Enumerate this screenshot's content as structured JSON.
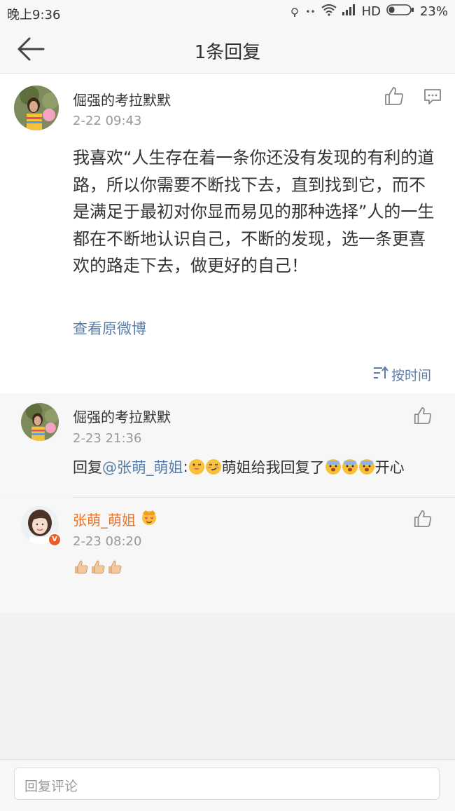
{
  "status_bar": {
    "time": "晚上9:36",
    "network": "HD",
    "battery": "23%"
  },
  "nav": {
    "title": "1条回复",
    "back_icon": "back-arrow-icon"
  },
  "post": {
    "username": "倔强的考拉默默",
    "time": "2-22 09:43",
    "content": "我喜欢“人生存在着一条你还没有发现的有利的道路，所以你需要不断找下去，直到找到它，而不是满足于最初对你显而易见的那种选择”人的一生都在不断地认识自己，不断的发现，选一条更喜欢的路走下去，做更好的自己！",
    "view_original": "查看原微博",
    "sort_label": "按时间"
  },
  "replies": [
    {
      "username": "倔强的考拉默默",
      "time": "2-23 21:36",
      "prefix": "回复",
      "mention": "@张萌_萌姐",
      "colon": ":",
      "text_mid": "萌姐给我回复了",
      "text_end": "开心",
      "emojis_a": [
        "tongue-emoji",
        "smirk-emoji"
      ],
      "emojis_b": [
        "scared-emoji",
        "scared-emoji",
        "scared-emoji"
      ]
    },
    {
      "username": "张萌_萌姐",
      "time": "2-23 08:20",
      "verified": true,
      "name_color": "#e8752c",
      "emojis": [
        "thumbs-up-emoji",
        "thumbs-up-emoji",
        "thumbs-up-emoji"
      ]
    }
  ],
  "input": {
    "placeholder": "回复评论"
  },
  "colors": {
    "link": "#5a7ea8",
    "accent_name": "#e8752c",
    "verified_badge": "#e8612c"
  }
}
